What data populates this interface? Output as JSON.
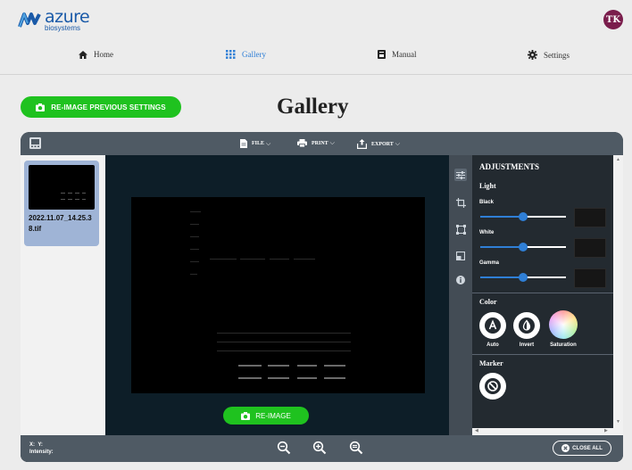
{
  "brand": {
    "name": "azure",
    "sub": "biosystems",
    "color": "#1a5aa8"
  },
  "user": {
    "initials": "TK"
  },
  "nav": [
    {
      "label": "Home",
      "icon": "home-icon"
    },
    {
      "label": "Gallery",
      "icon": "grid-icon",
      "active": true
    },
    {
      "label": "Manual",
      "icon": "book-icon"
    },
    {
      "label": "Settings",
      "icon": "gear-icon"
    }
  ],
  "actions": {
    "reimage_previous": "RE-IMAGE PREVIOUS SETTINGS",
    "reimage": "RE-IMAGE"
  },
  "page": {
    "title": "Gallery"
  },
  "toolbar": {
    "file": "FILE",
    "print": "PRINT",
    "export": "EXPORT"
  },
  "thumbnail": {
    "filename": "2022.11.07_14.25.38.tif"
  },
  "adjustments": {
    "title": "ADJUSTMENTS",
    "light": {
      "label": "Light",
      "black": {
        "label": "Black",
        "value": 0.5
      },
      "white": {
        "label": "White",
        "value": 0.5
      },
      "gamma": {
        "label": "Gamma",
        "value": 0.5
      }
    },
    "color": {
      "label": "Color",
      "auto": "Auto",
      "invert": "Invert",
      "saturation": "Saturation"
    },
    "marker": {
      "label": "Marker"
    }
  },
  "status": {
    "x_label": "X:",
    "y_label": "Y:",
    "intensity_label": "Intensity:"
  },
  "footer": {
    "close_all": "CLOSE ALL"
  },
  "colors": {
    "accent_green": "#1fc21f",
    "accent_blue": "#2f7fd6",
    "toolbar": "#4f5a64",
    "panel": "#232a30"
  }
}
